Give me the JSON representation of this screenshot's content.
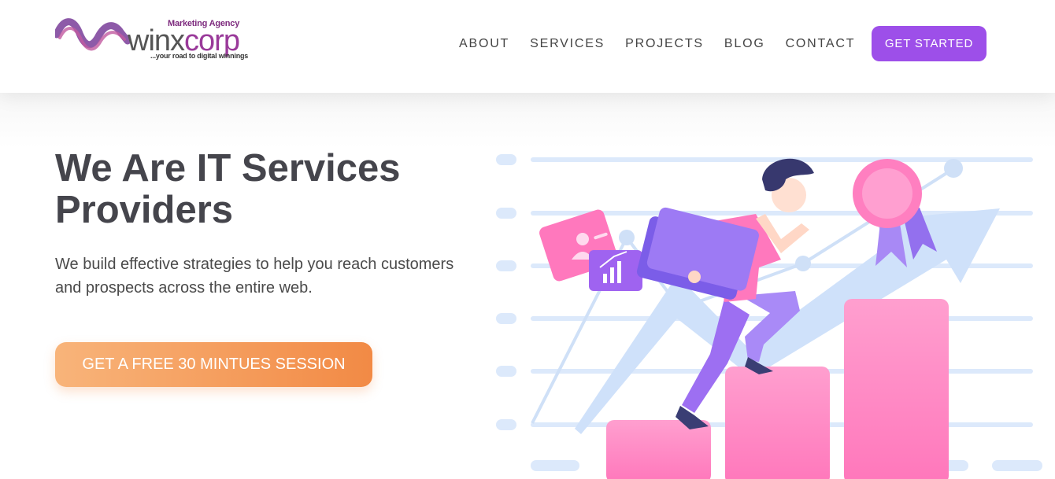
{
  "header": {
    "logo": {
      "tagline_top": "Marketing Agency",
      "word_part1": "winx",
      "word_part2": "corp",
      "tagline_bottom": "...your road to digital winnings"
    },
    "nav": [
      {
        "label": "ABOUT"
      },
      {
        "label": "SERVICES"
      },
      {
        "label": "PROJECTS"
      },
      {
        "label": "BLOG"
      },
      {
        "label": "CONTACT"
      }
    ],
    "cta_label": "GET STARTED"
  },
  "hero": {
    "title": "We Are IT Services Providers",
    "subtitle": "We build effective strategies to help you reach customers and prospects across the entire web.",
    "button_label": "GET A FREE 30 MINTUES SESSION"
  },
  "colors": {
    "accent_purple": "#9d4fe9",
    "accent_orange": "#f28a45",
    "brand_magenta": "#9a3a9a",
    "bar_pink": "#ff8dc4"
  },
  "icons": [
    "logo-wave-icon",
    "profile-card-icon",
    "bar-chart-icon",
    "folder-icon",
    "award-badge-icon",
    "growth-arrow-icon"
  ]
}
